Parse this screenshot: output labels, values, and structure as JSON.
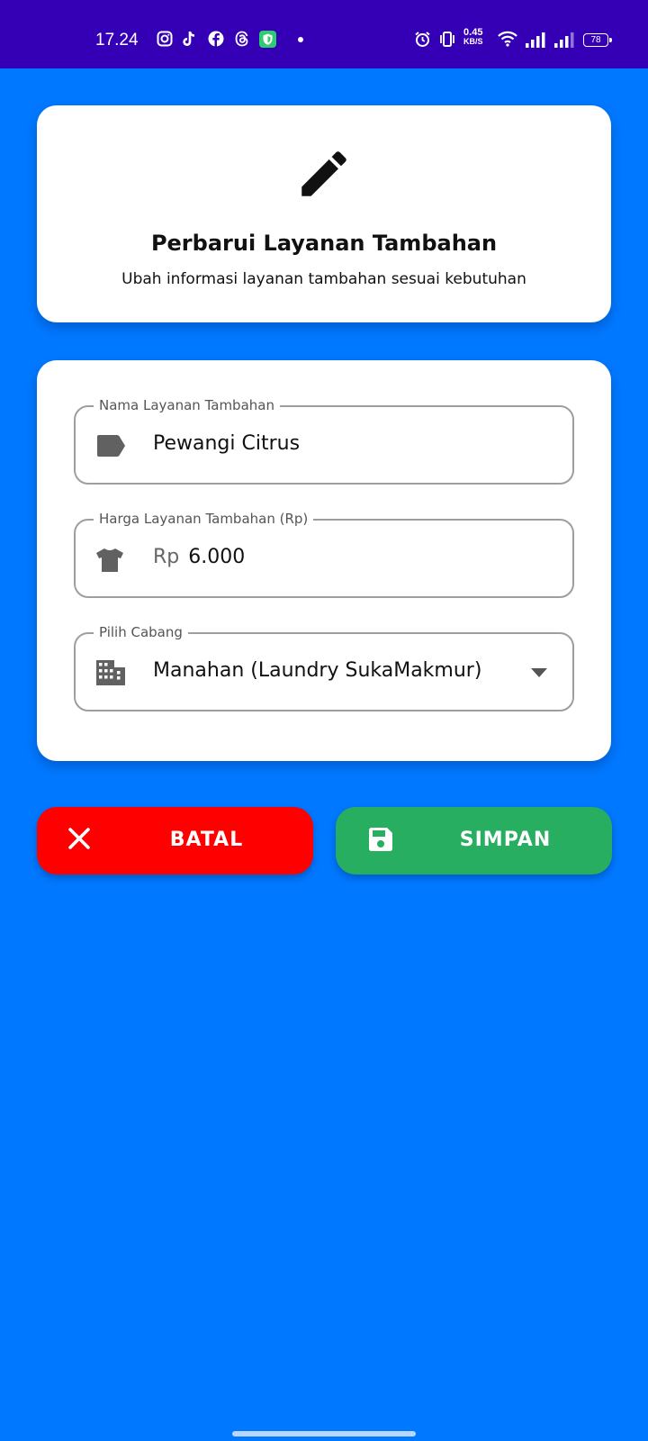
{
  "status_bar": {
    "time": "17.24",
    "net_speed_value": "0.45",
    "net_speed_unit": "KB/S",
    "battery": "78"
  },
  "header": {
    "title": "Perbarui Layanan Tambahan",
    "subtitle": "Ubah informasi layanan tambahan sesuai kebutuhan"
  },
  "form": {
    "name_field": {
      "label": "Nama Layanan Tambahan",
      "value": "Pewangi Citrus",
      "icon": "label-tag-icon"
    },
    "price_field": {
      "label": "Harga Layanan Tambahan (Rp)",
      "prefix": "Rp",
      "value": "6.000",
      "icon": "shirt-icon"
    },
    "branch_field": {
      "label": "Pilih Cabang",
      "value": "Manahan (Laundry SukaMakmur)",
      "icon": "building-icon"
    }
  },
  "buttons": {
    "cancel_label": "BATAL",
    "save_label": "SIMPAN"
  },
  "colors": {
    "background": "#0078FF",
    "status_bar": "#3500B5",
    "cancel": "#FF0000",
    "save": "#27AE60"
  }
}
